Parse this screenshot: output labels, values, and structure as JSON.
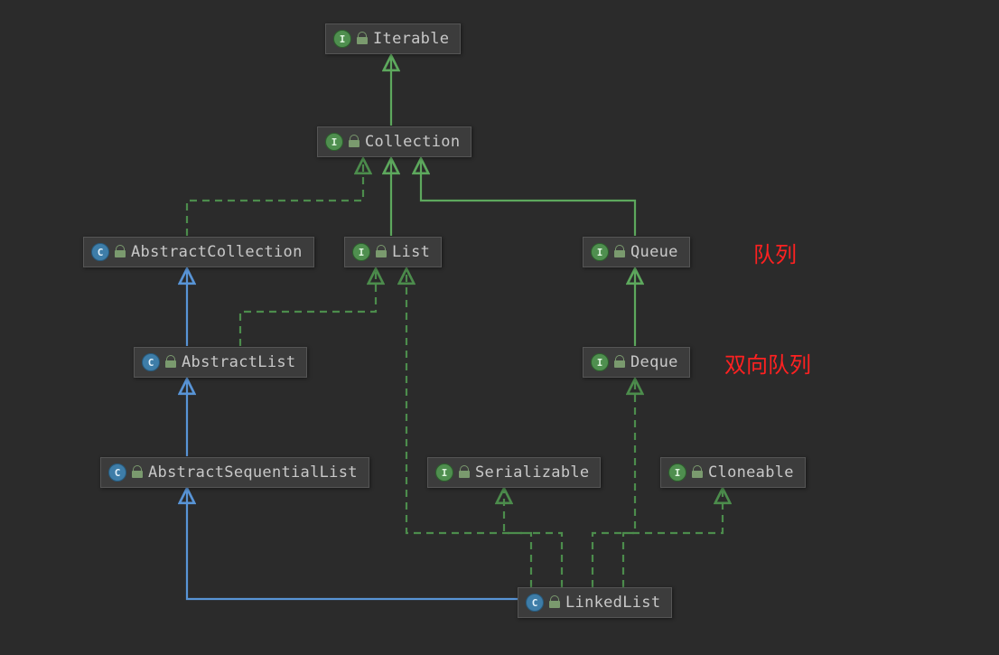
{
  "nodes": {
    "iterable": {
      "label": "Iterable",
      "kind": "interface"
    },
    "collection": {
      "label": "Collection",
      "kind": "interface"
    },
    "abstractCollection": {
      "label": "AbstractCollection",
      "kind": "class"
    },
    "list": {
      "label": "List",
      "kind": "interface"
    },
    "queue": {
      "label": "Queue",
      "kind": "interface"
    },
    "abstractList": {
      "label": "AbstractList",
      "kind": "class"
    },
    "deque": {
      "label": "Deque",
      "kind": "interface"
    },
    "abstractSequentialList": {
      "label": "AbstractSequentialList",
      "kind": "class"
    },
    "serializable": {
      "label": "Serializable",
      "kind": "interface"
    },
    "cloneable": {
      "label": "Cloneable",
      "kind": "interface"
    },
    "linkedList": {
      "label": "LinkedList",
      "kind": "class"
    }
  },
  "annotations": {
    "queueLabel": "队列",
    "dequeLabel": "双向队列"
  },
  "edges": [
    {
      "from": "collection",
      "to": "iterable",
      "type": "extends-iface"
    },
    {
      "from": "abstractCollection",
      "to": "collection",
      "type": "implements"
    },
    {
      "from": "list",
      "to": "collection",
      "type": "extends-iface"
    },
    {
      "from": "queue",
      "to": "collection",
      "type": "extends-iface"
    },
    {
      "from": "abstractList",
      "to": "abstractCollection",
      "type": "extends-class"
    },
    {
      "from": "abstractList",
      "to": "list",
      "type": "implements"
    },
    {
      "from": "deque",
      "to": "queue",
      "type": "extends-iface"
    },
    {
      "from": "abstractSequentialList",
      "to": "abstractList",
      "type": "extends-class"
    },
    {
      "from": "linkedList",
      "to": "abstractSequentialList",
      "type": "extends-class"
    },
    {
      "from": "linkedList",
      "to": "list",
      "type": "implements"
    },
    {
      "from": "linkedList",
      "to": "serializable",
      "type": "implements"
    },
    {
      "from": "linkedList",
      "to": "deque",
      "type": "implements"
    },
    {
      "from": "linkedList",
      "to": "cloneable",
      "type": "implements"
    }
  ],
  "colors": {
    "extendsClass": "#5894d6",
    "extendsIface": "#5da85d",
    "implements": "#4c8c4c"
  }
}
